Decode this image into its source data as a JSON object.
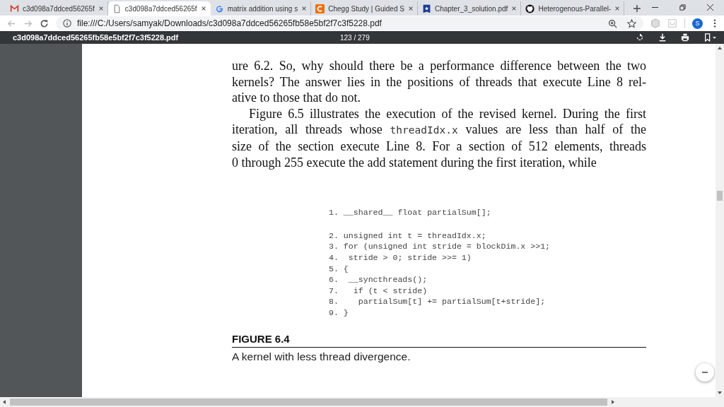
{
  "tabs": [
    {
      "title": "c3d098a7ddced56265f",
      "selected": false
    },
    {
      "title": "c3d098a7ddced56265f",
      "selected": true
    },
    {
      "title": "matrix addition using s",
      "selected": false
    },
    {
      "title": "Chegg Study | Guided S",
      "selected": false
    },
    {
      "title": "Chapter_3_solution.pdf",
      "selected": false
    },
    {
      "title": "Heterogenous-Parallel-",
      "selected": false
    }
  ],
  "address_bar": {
    "url": "file:///C:/Users/samyak/Downloads/c3d098a7ddced56265fb58e5bf2f7c3f5228.pdf",
    "avatar": "S"
  },
  "pdf_toolbar": {
    "filename": "c3d098a7ddced56265fb58e5bf2f7c3f5228.pdf",
    "page_indicator": "123 / 279"
  },
  "paragraphs": [
    {
      "indent": false,
      "lines": [
        [
          {
            "kind": "text",
            "text": "ure 6.2. So, why should there be a performance difference between the two"
          }
        ],
        [
          {
            "kind": "text",
            "text": "kernels? The answer lies in the positions of threads that execute Line 8 rel-"
          }
        ],
        [
          {
            "kind": "text",
            "text": "ative to those that do not."
          }
        ]
      ]
    },
    {
      "indent": true,
      "lines": [
        [
          {
            "kind": "text",
            "text": "Figure 6.5 illustrates the execution of the revised kernel. During the first"
          }
        ],
        [
          {
            "kind": "text",
            "text": "iteration, all threads whose "
          },
          {
            "kind": "code",
            "text": "threadIdx.x"
          },
          {
            "kind": "text",
            "text": " values are less than half of the"
          }
        ],
        [
          {
            "kind": "text",
            "text": "size of the section execute Line 8. For a section of 512 elements, threads"
          }
        ],
        [
          {
            "kind": "text",
            "text": "0 through 255 execute the add statement during the first iteration, while"
          }
        ]
      ]
    }
  ],
  "code_listing": [
    "1. __shared__ float partialSum[];",
    "2. unsigned int t = threadIdx.x;",
    "3. for (unsigned int stride = blockDim.x >>1;",
    "4.  stride > 0; stride >>= 1)",
    "5. {",
    "6.  __syncthreads();",
    "7.   if (t < stride)",
    "8.    partialSum[t] += partialSum[t+stride];",
    "9. }"
  ],
  "figure": {
    "label": "FIGURE 6.4",
    "caption": "A kernel with less thread divergence."
  }
}
